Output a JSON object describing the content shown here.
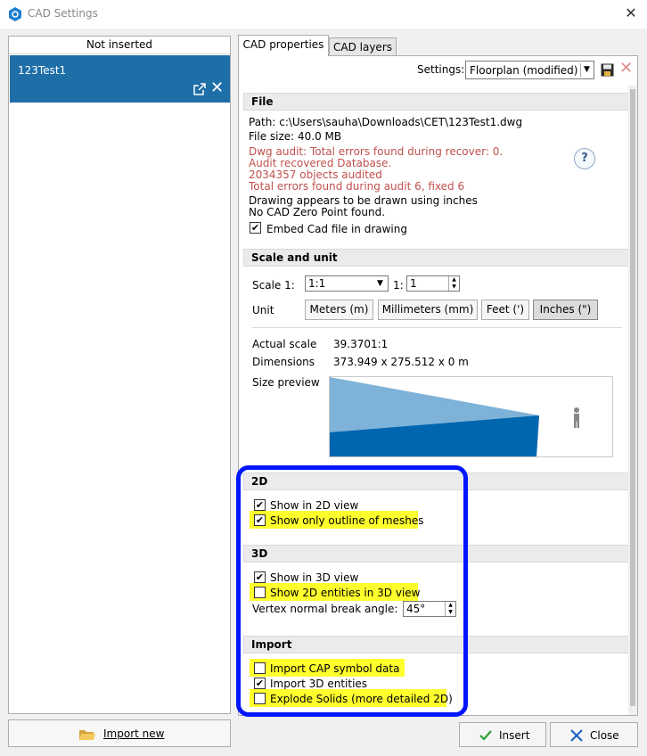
{
  "window": {
    "title": "CAD Settings",
    "close_icon": "close-icon"
  },
  "left_panel": {
    "header": "Not inserted",
    "items": [
      {
        "name": "123Test1"
      }
    ],
    "import_button": "Import new"
  },
  "tabs": [
    {
      "label": "CAD properties",
      "active": true
    },
    {
      "label": "CAD layers",
      "active": false
    }
  ],
  "settings": {
    "label": "Settings:",
    "value": "Floorplan (modified)"
  },
  "file": {
    "heading": "File",
    "path": "Path: c:\\Users\\sauha\\Downloads\\CET\\123Test1.dwg",
    "size": "File size: 40.0 MB",
    "audit_lines": [
      "Dwg audit: Total errors found during recover: 0.",
      "Audit recovered Database.",
      "2034357 objects audited",
      "Total errors found during audit 6, fixed 6"
    ],
    "info_lines": [
      "Drawing appears to be drawn using inches",
      "No CAD Zero Point found."
    ],
    "embed_label": "Embed Cad file in drawing",
    "embed_checked": true,
    "help_text": "?"
  },
  "scale_unit": {
    "heading": "Scale and unit",
    "scale_label": "Scale 1:",
    "scale_value": "1:1",
    "ratio_label": "1:",
    "ratio_value": "1",
    "unit_label": "Unit",
    "units": [
      "Meters (m)",
      "Millimeters (mm)",
      "Feet (')",
      "Inches (\")"
    ],
    "selected_unit": "Inches (\")",
    "actual_scale_label": "Actual scale",
    "actual_scale_value": "39.3701:1",
    "dimensions_label": "Dimensions",
    "dimensions_value": "373.949 x 275.512 x 0 m",
    "preview_label": "Size preview"
  },
  "section_2d": {
    "heading": "2D",
    "show_2d": {
      "label": "Show in 2D view",
      "checked": true
    },
    "outline_only": {
      "label": "Show only outline of meshes",
      "checked": true
    }
  },
  "section_3d": {
    "heading": "3D",
    "show_3d": {
      "label": "Show in 3D view",
      "checked": true
    },
    "show_2d_in_3d": {
      "label": "Show 2D entities in 3D view",
      "checked": false
    },
    "vertex_label": "Vertex normal break angle:",
    "vertex_value": "45°"
  },
  "section_import": {
    "heading": "Import",
    "cap_symbol": {
      "label": "Import CAP symbol data",
      "checked": false
    },
    "entities_3d": {
      "label": "Import 3D entities",
      "checked": true
    },
    "explode": {
      "label": "Explode Solids (more detailed 2D)",
      "checked": false
    }
  },
  "footer": {
    "insert": "Insert",
    "close": "Close"
  },
  "colors": {
    "selection": "#1e6ea7",
    "highlight": "#ffff2e",
    "annotation": "#0015ff",
    "preview_light": "#7eb2d8",
    "preview_dark": "#0066b0"
  }
}
